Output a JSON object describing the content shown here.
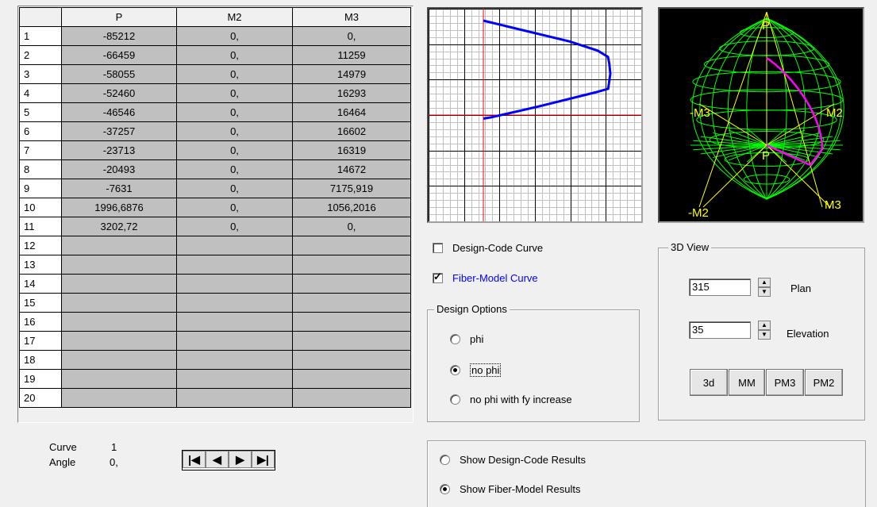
{
  "table": {
    "headers": [
      "",
      "P",
      "M2",
      "M3"
    ],
    "rows": [
      [
        "1",
        "-85212",
        "0,",
        "0,"
      ],
      [
        "2",
        "-66459",
        "0,",
        "11259"
      ],
      [
        "3",
        "-58055",
        "0,",
        "14979"
      ],
      [
        "4",
        "-52460",
        "0,",
        "16293"
      ],
      [
        "5",
        "-46546",
        "0,",
        "16464"
      ],
      [
        "6",
        "-37257",
        "0,",
        "16602"
      ],
      [
        "7",
        "-23713",
        "0,",
        "16319"
      ],
      [
        "8",
        "-20493",
        "0,",
        "14672"
      ],
      [
        "9",
        "-7631",
        "0,",
        "7175,919"
      ],
      [
        "10",
        "1996,6876",
        "0,",
        "1056,2016"
      ],
      [
        "11",
        "3202,72",
        "0,",
        "0,"
      ],
      [
        "12",
        "",
        "",
        ""
      ],
      [
        "13",
        "",
        "",
        ""
      ],
      [
        "14",
        "",
        "",
        ""
      ],
      [
        "15",
        "",
        "",
        ""
      ],
      [
        "16",
        "",
        "",
        ""
      ],
      [
        "17",
        "",
        "",
        ""
      ],
      [
        "18",
        "",
        "",
        ""
      ],
      [
        "19",
        "",
        "",
        ""
      ],
      [
        "20",
        "",
        "",
        ""
      ]
    ]
  },
  "curve_info": {
    "curve_label": "Curve",
    "curve_value": "1",
    "angle_label": "Angle",
    "angle_value": "0,"
  },
  "nav": {
    "first": "|◀",
    "prev": "◀",
    "next": "▶",
    "last": "▶|"
  },
  "checkboxes": {
    "design_code_curve": {
      "label": "Design-Code Curve",
      "checked": false
    },
    "fiber_model_curve": {
      "label": "Fiber-Model Curve",
      "checked": true,
      "color": "#0000ff"
    }
  },
  "design_options": {
    "title": "Design Options",
    "options": [
      {
        "label": "phi",
        "selected": false
      },
      {
        "label": "no phi",
        "selected": true
      },
      {
        "label": "no phi with fy increase",
        "selected": false
      }
    ]
  },
  "view3d_panel": {
    "title": "3D View",
    "plan_label": "Plan",
    "plan_value": "315",
    "elevation_label": "Elevation",
    "elevation_value": "35",
    "buttons": [
      "3d",
      "MM",
      "PM3",
      "PM2"
    ]
  },
  "results": {
    "options": [
      {
        "label": "Show Design-Code Results",
        "selected": false
      },
      {
        "label": "Show Fiber-Model Results",
        "selected": true
      }
    ]
  },
  "view3d_labels": {
    "p_top": "P",
    "p_center": "P",
    "neg_m3": "-M3",
    "m2": "M2",
    "neg_m2": "-M2",
    "m3": "M3"
  },
  "colors": {
    "curve": "#0000ff",
    "axes": "#ff0000",
    "mesh": "#00ff00",
    "axis3d": "#ffff00",
    "trace": "#ff00ff"
  }
}
